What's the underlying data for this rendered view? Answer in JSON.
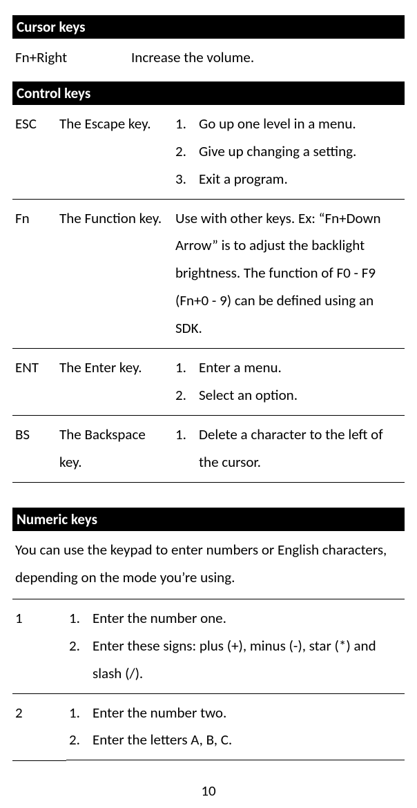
{
  "sections": {
    "cursor": {
      "title": "Cursor keys",
      "rows": [
        {
          "key": "Fn+Right",
          "desc": "Increase the volume."
        }
      ]
    },
    "control": {
      "title": "Control keys",
      "rows": [
        {
          "key": "ESC",
          "name": "The Escape key.",
          "items": [
            "Go up one level in a menu.",
            "Give up changing a setting.",
            "Exit a program."
          ]
        },
        {
          "key": "Fn",
          "name": "The Function key.",
          "text": "Use with other keys. Ex: “Fn+Down Arrow” is to adjust the backlight brightness. The function of F0 - F9 (Fn+0 - 9) can be defined using an SDK."
        },
        {
          "key": "ENT",
          "name": "The Enter key.",
          "items": [
            "Enter a menu.",
            "Select an option."
          ]
        },
        {
          "key": "BS",
          "name": "The Backspace key.",
          "items": [
            "Delete a character to the left of the cursor."
          ]
        }
      ]
    },
    "numeric": {
      "title": "Numeric keys",
      "intro": "You can use the keypad to enter numbers or English characters, depending on the mode you’re using.",
      "rows": [
        {
          "key": "1",
          "items": [
            "Enter the number one.",
            "Enter these signs: plus (+), minus (-), star (*) and slash (/)."
          ]
        },
        {
          "key": "2",
          "items": [
            "Enter the number two.",
            "Enter the letters A, B, C."
          ]
        }
      ]
    }
  },
  "page_number": "10",
  "numbers": [
    "1.",
    "2.",
    "3."
  ]
}
